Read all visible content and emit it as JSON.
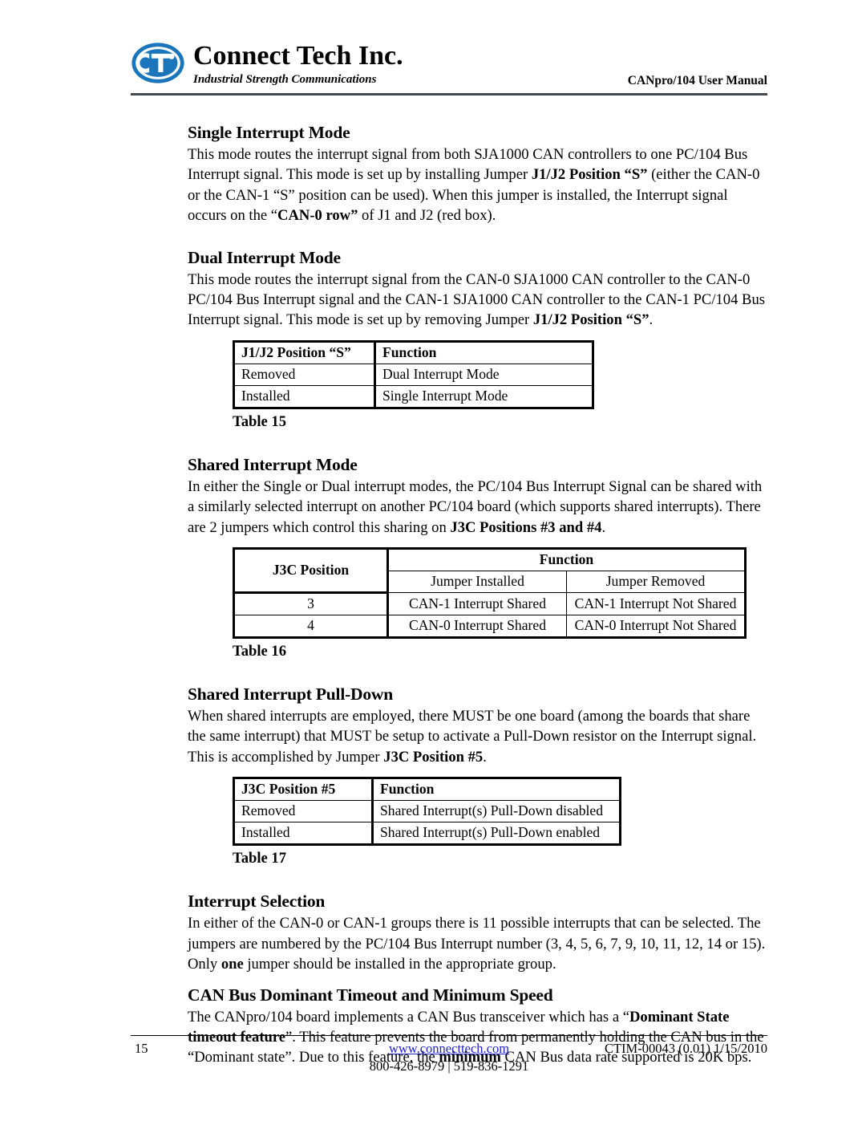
{
  "header": {
    "brand_name": "Connect Tech Inc.",
    "brand_tagline": "Industrial Strength Communications",
    "logo_icon": "cti-oval-logo-icon",
    "manual_title": "CANpro/104 User Manual",
    "logo_color": "#1a75bb",
    "rule_color": "#444b54"
  },
  "sections": [
    {
      "heading": "Single Interrupt Mode",
      "paragraph_parts": [
        {
          "text": "This mode routes the interrupt signal from both SJA1000 CAN controllers to one PC/104 Bus Interrupt signal. This mode is set up by installing Jumper ",
          "bold": false
        },
        {
          "text": "J1/J2 Position “S”",
          "bold": true
        },
        {
          "text": " (either the CAN-0 or the CAN-1 “S” position can be used). When this jumper is installed, the Interrupt signal occurs on the “",
          "bold": false
        },
        {
          "text": "CAN-0 row”",
          "bold": true
        },
        {
          "text": " of J1 and J2 (red box).",
          "bold": false
        }
      ]
    },
    {
      "heading": "Dual Interrupt Mode",
      "paragraph_parts": [
        {
          "text": "This mode routes the interrupt signal from the CAN-0 SJA1000 CAN controller to the CAN-0 PC/104 Bus Interrupt signal and the CAN-1 SJA1000 CAN controller to the CAN-1 PC/104 Bus Interrupt signal. This mode is set up by removing Jumper ",
          "bold": false
        },
        {
          "text": "J1/J2 Position “S”",
          "bold": true
        },
        {
          "text": ".",
          "bold": false
        }
      ]
    },
    {
      "heading": "Shared Interrupt Mode",
      "paragraph_parts": [
        {
          "text": "In either the Single or Dual interrupt modes, the PC/104 Bus Interrupt Signal can be shared with a similarly selected interrupt on another PC/104 board (which supports shared interrupts). There are 2 jumpers which control this sharing on ",
          "bold": false
        },
        {
          "text": "J3C Positions #3 and #4",
          "bold": true
        },
        {
          "text": ".",
          "bold": false
        }
      ]
    },
    {
      "heading": "Shared Interrupt Pull-Down",
      "paragraph_parts": [
        {
          "text": "When shared interrupts are employed, there MUST be one board (among the boards that share the same interrupt) that MUST be setup to activate a Pull-Down resistor on the Interrupt signal. This is accomplished by Jumper ",
          "bold": false
        },
        {
          "text": "J3C Position #5",
          "bold": true
        },
        {
          "text": ".",
          "bold": false
        }
      ]
    },
    {
      "heading": "Interrupt Selection",
      "paragraph_parts": [
        {
          "text": "In either of the CAN-0 or CAN-1 groups there is 11 possible interrupts that can be selected. The jumpers are numbered by the PC/104 Bus Interrupt number (3, 4, 5, 6, 7, 9, 10, 11, 12, 14 or 15). Only ",
          "bold": false
        },
        {
          "text": "one",
          "bold": true
        },
        {
          "text": " jumper should be installed in the appropriate group.",
          "bold": false
        }
      ]
    },
    {
      "heading": "CAN Bus Dominant Timeout and Minimum Speed",
      "paragraph_parts": [
        {
          "text": "The CANpro/104 board implements a CAN Bus transceiver which has a “",
          "bold": false
        },
        {
          "text": "Dominant State timeout feature",
          "bold": true
        },
        {
          "text": "”. This feature prevents the board from permanently holding the CAN bus in the “Dominant state”. Due to this feature, the ",
          "bold": false
        },
        {
          "text": "minimum",
          "bold": true
        },
        {
          "text": " CAN Bus data rate supported is 20K bps.",
          "bold": false
        }
      ]
    }
  ],
  "tables": {
    "table15": {
      "caption": "Table 15",
      "headers": [
        "J1/J2 Position “S”",
        "Function"
      ],
      "rows": [
        [
          "Removed",
          "Dual Interrupt Mode"
        ],
        [
          "Installed",
          "Single Interrupt Mode"
        ]
      ]
    },
    "table16": {
      "caption": "Table 16",
      "header_col1": "J3C Position",
      "header_group": "Function",
      "subheaders": [
        "Jumper Installed",
        "Jumper Removed"
      ],
      "rows": [
        [
          "3",
          "CAN-1 Interrupt Shared",
          "CAN-1 Interrupt Not Shared"
        ],
        [
          "4",
          "CAN-0 Interrupt Shared",
          "CAN-0 Interrupt Not Shared"
        ]
      ]
    },
    "table17": {
      "caption": "Table 17",
      "headers": [
        "J3C Position #5",
        "Function"
      ],
      "rows": [
        [
          "Removed",
          "Shared Interrupt(s) Pull-Down disabled"
        ],
        [
          "Installed",
          "Shared Interrupt(s) Pull-Down enabled"
        ]
      ]
    }
  },
  "footer": {
    "page_number": "15",
    "website": "www.connecttech.com",
    "phones": "800-426-8979 | 519-836-1291",
    "doc_id": "CTIM-00043 (0.01) 1/15/2010",
    "link_color": "#2222cc"
  }
}
